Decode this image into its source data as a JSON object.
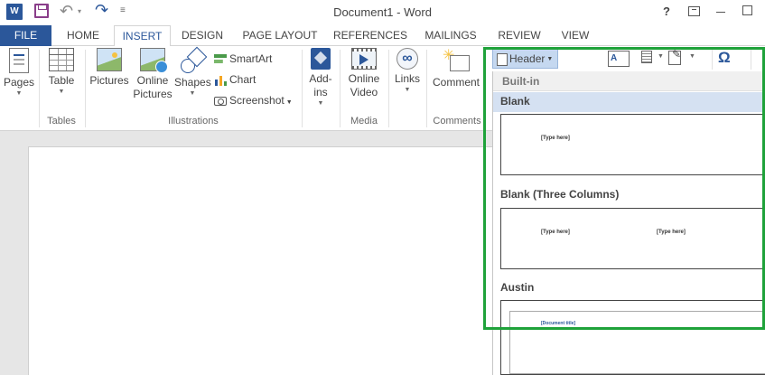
{
  "window": {
    "title": "Document1 - Word",
    "app_icon_letter": "W",
    "help_label": "?"
  },
  "tabs": [
    "FILE",
    "HOME",
    "INSERT",
    "DESIGN",
    "PAGE LAYOUT",
    "REFERENCES",
    "MAILINGS",
    "REVIEW",
    "VIEW"
  ],
  "active_tab": "INSERT",
  "ribbon": {
    "pages": {
      "label": "Pages"
    },
    "tables": {
      "label": "Table",
      "group": "Tables"
    },
    "illustrations": {
      "pictures": "Pictures",
      "online_pictures_1": "Online",
      "online_pictures_2": "Pictures",
      "shapes": "Shapes",
      "smartart": "SmartArt",
      "chart": "Chart",
      "screenshot": "Screenshot",
      "group": "Illustrations"
    },
    "addins": {
      "label_1": "Add-",
      "label_2": "ins"
    },
    "media": {
      "label_1": "Online",
      "label_2": "Video",
      "group": "Media"
    },
    "links": {
      "label": "Links"
    },
    "comments": {
      "label": "Comment",
      "group": "Comments"
    }
  },
  "header_toolbar": {
    "header_button": "Header",
    "textbox_glyph": "A",
    "symbol_glyph": "Ω"
  },
  "gallery": {
    "section": "Built-in",
    "items": [
      {
        "name": "Blank",
        "placeholders": [
          "[Type here]"
        ]
      },
      {
        "name": "Blank (Three Columns)",
        "placeholders": [
          "[Type here]",
          "[Type here]"
        ]
      },
      {
        "name": "Austin",
        "placeholders": [
          "[Document title]"
        ]
      }
    ]
  },
  "colors": {
    "file_tab": "#2b579a",
    "accent": "#2b579a",
    "highlight": "#1fa23a",
    "selected_item": "#d5e1f2"
  }
}
